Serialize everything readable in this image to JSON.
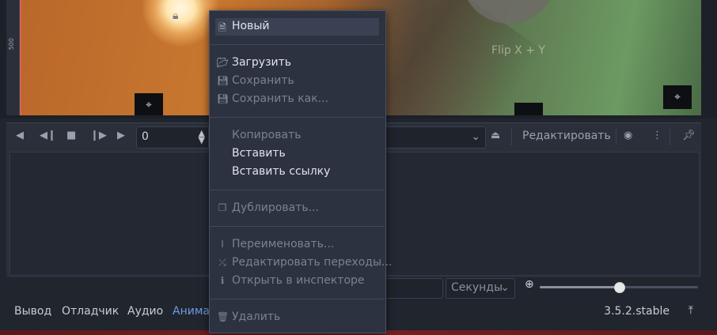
{
  "viewport": {
    "ruler_mark": "500",
    "flip_label": "Flip X + Y"
  },
  "toolbar": {
    "frame_value": "0",
    "edit_label": "Редактировать"
  },
  "timeline": {
    "units": "Секунды",
    "zoom_level": 0.5
  },
  "bottom_tabs": [
    "Вывод",
    "Отладчик",
    "Аудио",
    "Анима"
  ],
  "version": "3.5.2.stable",
  "context_menu": {
    "items": [
      {
        "label": "Новый",
        "icon": "new-file-icon",
        "enabled": true,
        "highlighted": true
      },
      {
        "label": "Загрузить",
        "icon": "folder-open-icon",
        "enabled": true
      },
      {
        "label": "Сохранить",
        "icon": "save-icon",
        "enabled": false
      },
      {
        "label": "Сохранить как...",
        "icon": "save-as-icon",
        "enabled": false
      },
      {
        "label": "Копировать",
        "icon": "",
        "enabled": false
      },
      {
        "label": "Вставить",
        "icon": "",
        "enabled": true
      },
      {
        "label": "Вставить ссылку",
        "icon": "",
        "enabled": true
      },
      {
        "label": "Дублировать...",
        "icon": "duplicate-icon",
        "enabled": false
      },
      {
        "label": "Переименовать...",
        "icon": "rename-icon",
        "enabled": false
      },
      {
        "label": "Редактировать переходы...",
        "icon": "transitions-icon",
        "enabled": false
      },
      {
        "label": "Открыть в инспекторе",
        "icon": "inspector-icon",
        "enabled": false
      },
      {
        "label": "Удалить",
        "icon": "trash-icon",
        "enabled": false
      }
    ]
  },
  "colors": {
    "accent": "#6e9ce0",
    "menu_bg": "#2c3240",
    "panel_bg": "#2a2f3a"
  }
}
